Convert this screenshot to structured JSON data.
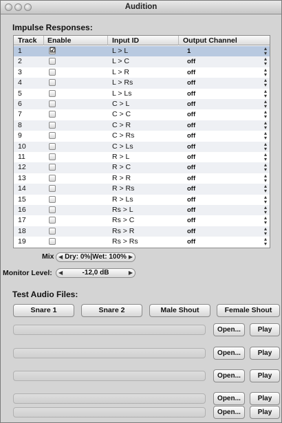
{
  "window": {
    "title": "Audition"
  },
  "impulse": {
    "heading": "Impulse Responses:",
    "columns": {
      "track": "Track",
      "enable": "Enable",
      "input_id": "Input ID",
      "output_channel": "Output Channel"
    },
    "rows": [
      {
        "track": "1",
        "enabled": true,
        "input": "L > L",
        "output": "1",
        "selected": true
      },
      {
        "track": "2",
        "enabled": false,
        "input": "L > C",
        "output": "off"
      },
      {
        "track": "3",
        "enabled": false,
        "input": "L > R",
        "output": "off"
      },
      {
        "track": "4",
        "enabled": false,
        "input": "L > Rs",
        "output": "off"
      },
      {
        "track": "5",
        "enabled": false,
        "input": "L > Ls",
        "output": "off"
      },
      {
        "track": "6",
        "enabled": false,
        "input": "C > L",
        "output": "off"
      },
      {
        "track": "7",
        "enabled": false,
        "input": "C > C",
        "output": "off"
      },
      {
        "track": "8",
        "enabled": false,
        "input": "C > R",
        "output": "off"
      },
      {
        "track": "9",
        "enabled": false,
        "input": "C > Rs",
        "output": "off"
      },
      {
        "track": "10",
        "enabled": false,
        "input": "C > Ls",
        "output": "off"
      },
      {
        "track": "11",
        "enabled": false,
        "input": "R > L",
        "output": "off"
      },
      {
        "track": "12",
        "enabled": false,
        "input": "R > C",
        "output": "off"
      },
      {
        "track": "13",
        "enabled": false,
        "input": "R > R",
        "output": "off"
      },
      {
        "track": "14",
        "enabled": false,
        "input": "R > Rs",
        "output": "off"
      },
      {
        "track": "15",
        "enabled": false,
        "input": "R > Ls",
        "output": "off"
      },
      {
        "track": "16",
        "enabled": false,
        "input": "Rs > L",
        "output": "off"
      },
      {
        "track": "17",
        "enabled": false,
        "input": "Rs > C",
        "output": "off"
      },
      {
        "track": "18",
        "enabled": false,
        "input": "Rs > R",
        "output": "off"
      },
      {
        "track": "19",
        "enabled": false,
        "input": "Rs > Rs",
        "output": "off"
      }
    ],
    "icons": {
      "checkmark": "☑",
      "updown": "up-down-arrows-icon"
    }
  },
  "mix": {
    "label": "Mix",
    "value": "Dry: 0%|Wet: 100%"
  },
  "monitor": {
    "label": "Monitor Level:",
    "value": "-12,0 dB"
  },
  "test_audio": {
    "heading": "Test Audio Files:",
    "presets": [
      "Snare 1",
      "Snare 2",
      "Male Shout",
      "Female Shout"
    ],
    "files": [
      {
        "path": "",
        "open_label": "Open...",
        "play_label": "Play"
      },
      {
        "path": "",
        "open_label": "Open...",
        "play_label": "Play"
      },
      {
        "path": "",
        "open_label": "Open...",
        "play_label": "Play"
      },
      {
        "path": "",
        "open_label": "Open...",
        "play_label": "Play"
      },
      {
        "path": "",
        "open_label": "Open...",
        "play_label": "Play"
      }
    ]
  }
}
